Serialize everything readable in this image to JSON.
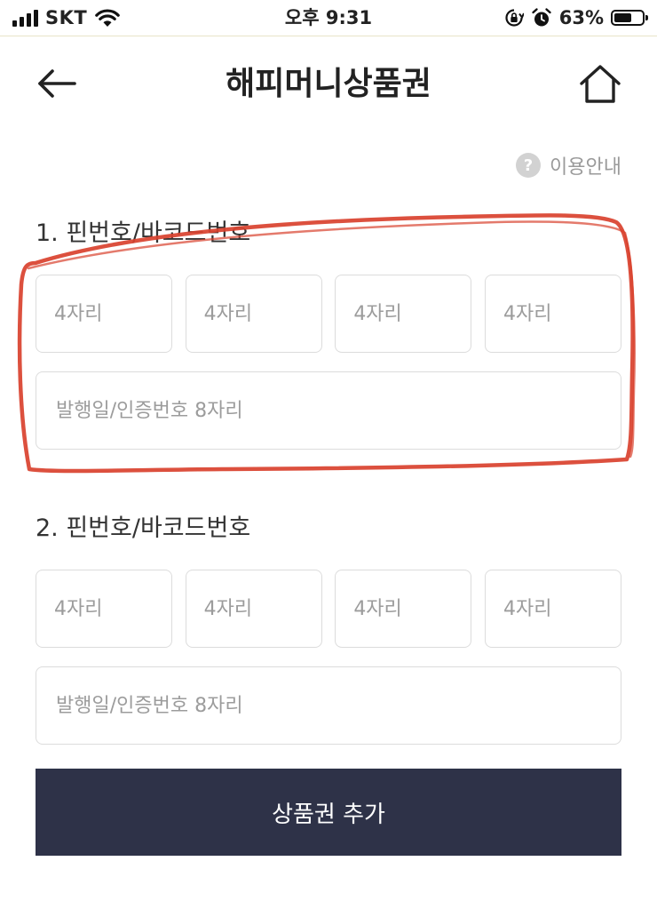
{
  "status_bar": {
    "carrier": "SKT",
    "time": "오후 9:31",
    "battery_percent": "63%",
    "battery_level": 0.63,
    "icons": [
      "signal-icon",
      "wifi-icon",
      "orientation-lock-icon",
      "alarm-icon",
      "battery-icon"
    ]
  },
  "header": {
    "title": "해피머니상품권",
    "back_icon": "arrow-left-icon",
    "home_icon": "home-icon"
  },
  "guide": {
    "icon_glyph": "?",
    "label": "이용안내"
  },
  "vouchers": [
    {
      "label": "1. 핀번호/바코드번호",
      "pin_placeholders": [
        "4자리",
        "4자리",
        "4자리",
        "4자리"
      ],
      "pin_values": [
        "",
        "",
        "",
        ""
      ],
      "auth_placeholder": "발행일/인증번호 8자리",
      "auth_value": ""
    },
    {
      "label": "2. 핀번호/바코드번호",
      "pin_placeholders": [
        "4자리",
        "4자리",
        "4자리",
        "4자리"
      ],
      "pin_values": [
        "",
        "",
        "",
        ""
      ],
      "auth_placeholder": "발행일/인증번호 8자리",
      "auth_value": ""
    }
  ],
  "add_button": {
    "label": "상품권 추가"
  },
  "colors": {
    "button_background": "#2e3248",
    "input_border": "#dcdcdc",
    "placeholder": "#9c9c9c",
    "annotation_red": "#d9412e"
  }
}
